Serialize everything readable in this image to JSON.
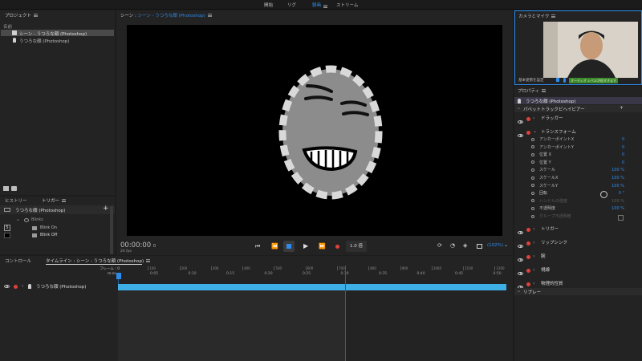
{
  "topnav": {
    "tabs": [
      "開始",
      "リグ",
      "録画",
      "ストリーム"
    ],
    "active": 2
  },
  "project": {
    "title": "プロジェクト",
    "col_name": "名前",
    "items": [
      "シーン - うつろな顔 (Photoshop)",
      "うつろな顔 (Photoshop)"
    ]
  },
  "scene": {
    "label_prefix": "シーン :",
    "label_name": "シーン - うつろな顔 (Photoshop)"
  },
  "history": {
    "tab_history": "ヒストリー",
    "tab_triggers": "トリガー",
    "puppet": "うつろな顔 (Photoshop)",
    "group": "Blinks",
    "items": [
      "Blink On",
      "Blink Off"
    ],
    "key": "5"
  },
  "transport": {
    "timecode": "00:00:00",
    "frame": "0",
    "fps": "24 fps",
    "speed": "1.0 倍",
    "zoom": "(102%)"
  },
  "timeline": {
    "tab_controls": "コントロール",
    "tab_timeline": "タイムライン : シーン - うつろな顔 (Photoshop)",
    "frame_label": "フレーム : 0",
    "time_label": "m:ss",
    "frame_ticks": [
      "100",
      "200",
      "300",
      "400",
      "500",
      "600",
      "700",
      "800",
      "900",
      "1000",
      "1100",
      "1200"
    ],
    "time_ticks": [
      "0:05",
      "0:10",
      "0:15",
      "0:20",
      "0:25",
      "0:30",
      "0:35",
      "0:40",
      "0:45",
      "0:50"
    ],
    "track": "うつろな顔 (Photoshop)"
  },
  "camera": {
    "title": "カメラとマイク",
    "reset_btn": "基本姿勢を設定",
    "mic_label": "オーディオ レベルが低すぎます"
  },
  "properties": {
    "title": "プロパティ",
    "puppet": "うつろな顔 (Photoshop)",
    "section": "パペットトラックビヘイビアー",
    "behaviors": [
      "ドラッガー",
      "トランスフォーム",
      "トリガー",
      "リップシンク",
      "腕",
      "視線",
      "物理的性質"
    ],
    "transform_params": [
      {
        "label": "アンカーポイントX",
        "value": "0"
      },
      {
        "label": "アンカーポイントY",
        "value": "0"
      },
      {
        "label": "位置 X",
        "value": "0"
      },
      {
        "label": "位置 Y",
        "value": "0"
      },
      {
        "label": "スケール",
        "value": "100 %"
      },
      {
        "label": "スケールX",
        "value": "100 %"
      },
      {
        "label": "スケールY",
        "value": "100 %"
      },
      {
        "label": "回転",
        "value": "0 °"
      },
      {
        "label": "ハンドルの強度",
        "value": "100 %"
      },
      {
        "label": "不透明度",
        "value": "100 %"
      },
      {
        "label": "グループ不透明度",
        "value": ""
      }
    ],
    "replay": "リプレー"
  },
  "colors": {
    "accent": "#2d8ceb",
    "track": "#3eaee6",
    "record": "#e0413b",
    "puppet_face": "#8c8c8c"
  }
}
